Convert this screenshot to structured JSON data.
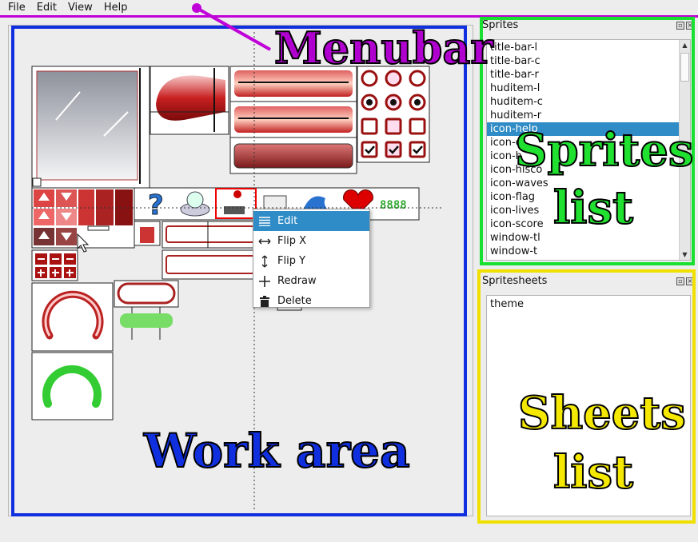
{
  "menubar": {
    "items": [
      "File",
      "Edit",
      "View",
      "Help"
    ]
  },
  "sprites_panel": {
    "title": "Sprites",
    "items": [
      "title-bar-l",
      "title-bar-c",
      "title-bar-r",
      "huditem-l",
      "huditem-c",
      "huditem-r",
      "icon-help",
      "icon-c",
      "icon-h",
      "icon-hisco",
      "icon-waves",
      "icon-flag",
      "icon-lives",
      "icon-score",
      "window-tl",
      "window-t"
    ],
    "selected_index": 6
  },
  "spritesheets_panel": {
    "title": "Spritesheets",
    "items": [
      "theme"
    ]
  },
  "context_menu": {
    "items": [
      {
        "label": "Edit",
        "icon": "list-icon",
        "selected": true
      },
      {
        "label": "Flip X",
        "icon": "flip-horizontal-icon",
        "selected": false
      },
      {
        "label": "Flip Y",
        "icon": "flip-vertical-icon",
        "selected": false
      },
      {
        "label": "Redraw",
        "icon": "plus-icon",
        "selected": false
      },
      {
        "label": "Delete",
        "icon": "trash-icon",
        "selected": false
      }
    ]
  },
  "annotations": {
    "menubar": "Menubar",
    "work_area": "Work area",
    "sprites_list_1": "Sprites",
    "sprites_list_2": "list",
    "sheets_list_1": "Sheets",
    "sheets_list_2": "list"
  },
  "colors": {
    "menubar": "#c000d8",
    "work_area": "#1030e0",
    "sprites": "#18e030",
    "sheets": "#f0e000",
    "selection": "#308cc6"
  }
}
